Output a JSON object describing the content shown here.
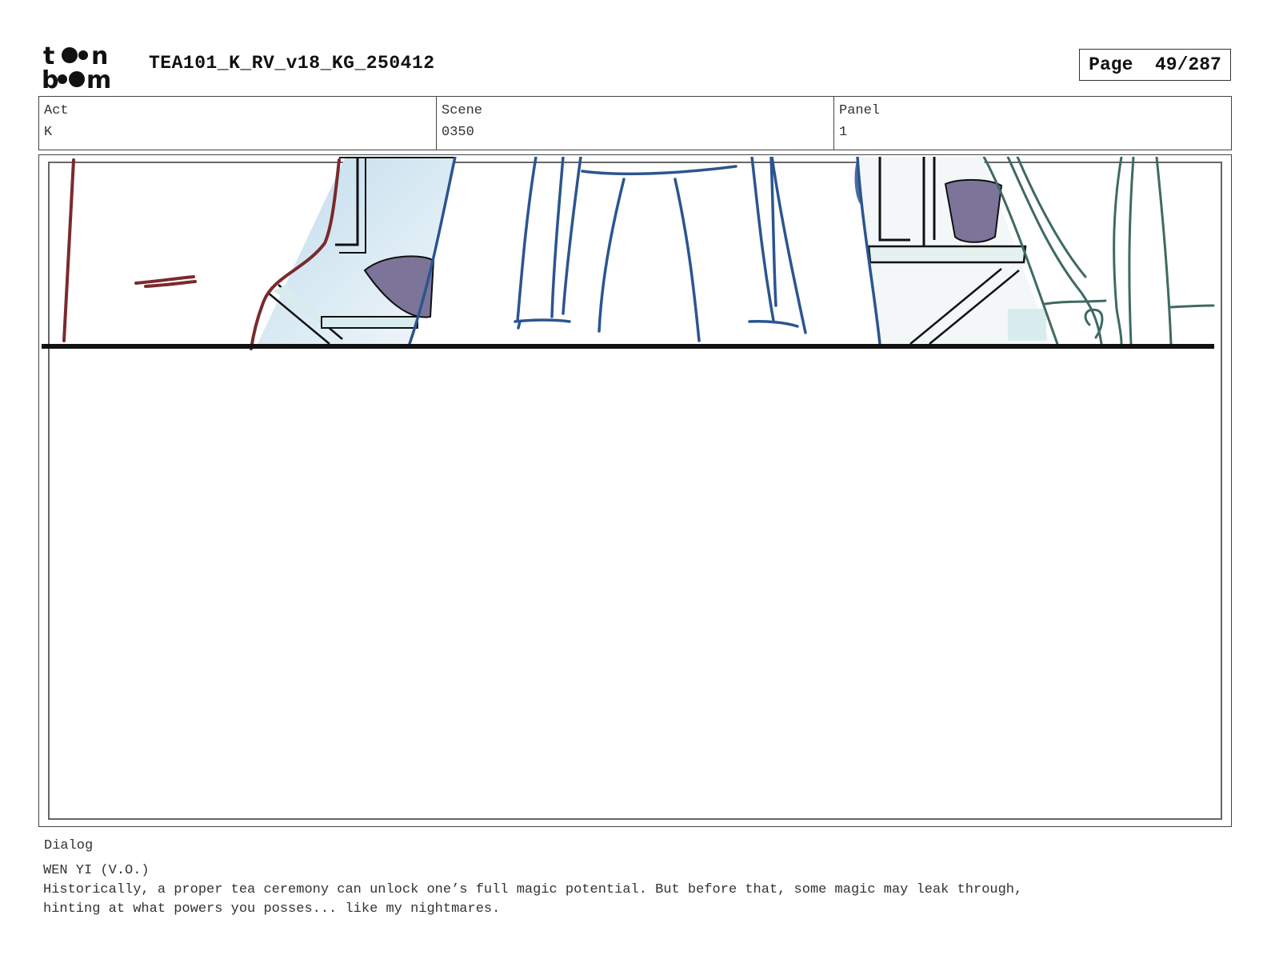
{
  "header": {
    "logo": {
      "line1": "toon",
      "line2": "boom"
    },
    "document_title": "TEA101_K_RV_v18_KG_250412",
    "page_label": "Page",
    "page_number": "49/287"
  },
  "meta": {
    "act": {
      "label": "Act",
      "value": "K"
    },
    "scene": {
      "label": "Scene",
      "value": "0350"
    },
    "panel": {
      "label": "Panel",
      "value": "1"
    }
  },
  "panel": {
    "colors": {
      "line_blue": "#2c5590",
      "line_red": "#7a2a2e",
      "line_green": "#3e6a62",
      "glass_tint": "#cfe6f1",
      "bowl": "#7c7499"
    }
  },
  "dialog": {
    "label": "Dialog",
    "speaker": "WEN YI (V.O.)",
    "text": "Historically, a proper tea ceremony can unlock one’s full magic potential. But before that, some magic may leak through,\nhinting at what powers you posses... like my nightmares."
  }
}
